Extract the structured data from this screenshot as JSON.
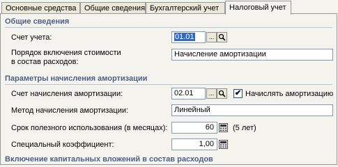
{
  "tabs": [
    "Основные средства",
    "Общие сведения",
    "Бухгалтерский учет",
    "Налоговый учет"
  ],
  "sections": {
    "general": "Общие сведения",
    "depreciation": "Параметры начисления амортизации",
    "capital": "Включение капитальных вложений в состав расходов"
  },
  "general": {
    "account_label": "Счет учета:",
    "account_value": "01.01",
    "dots": "...",
    "order_label_1": "Порядок включения стоимости",
    "order_label_2": "в состав расходов:",
    "order_value": "Начисление амортизации"
  },
  "depreciation": {
    "account_label": "Счет начисления амортизации:",
    "account_value": "02.01",
    "dots": "...",
    "accrue_label": "Начислять амортизацию",
    "accrue_checked": "✔",
    "method_label": "Метод начисления амортизации:",
    "method_value": "Линейный",
    "term_label": "Срок полезного использования (в месяцах):",
    "term_value": "60",
    "term_years": "(5 лет)",
    "coef_label": "Специальный коэффициент:",
    "coef_value": "1,00"
  },
  "icons": {
    "search": "magnifier-icon",
    "calc": "calculator-icon"
  }
}
